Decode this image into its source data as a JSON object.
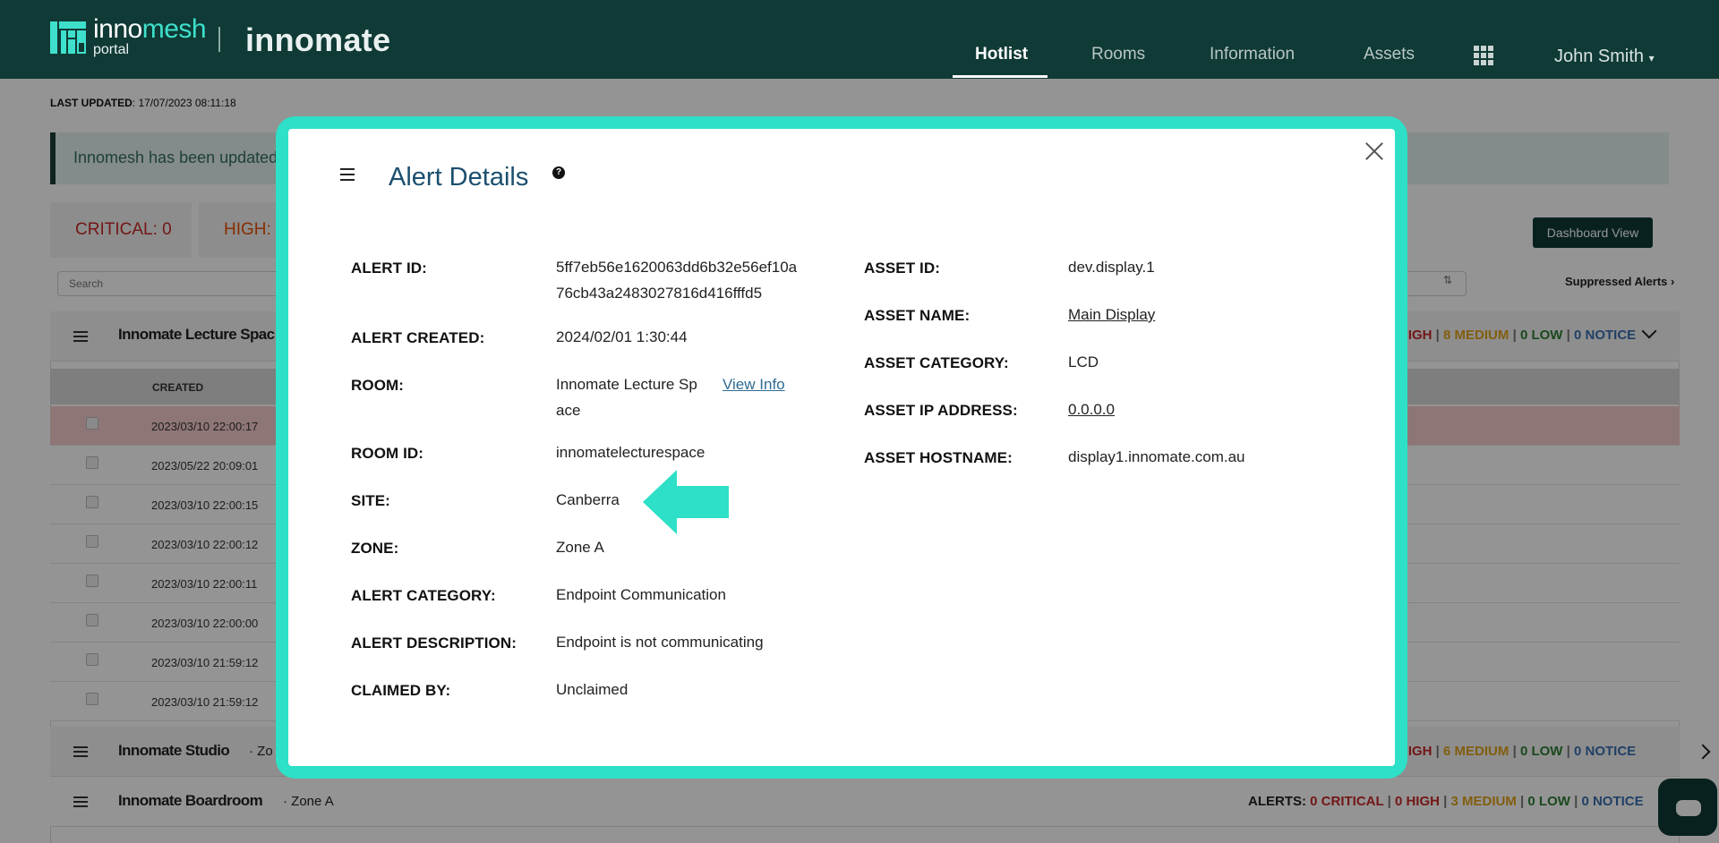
{
  "nav": {
    "brand_left": "inno",
    "brand_right": "mesh",
    "brand_sub": "portal",
    "brand2": "innomate",
    "links": [
      "Hotlist",
      "Rooms",
      "Information",
      "Assets"
    ],
    "active": "Hotlist",
    "user": "John Smith"
  },
  "page": {
    "last_updated_label": "LAST UPDATED",
    "last_updated_value": ": 17/07/2023 08:11:18",
    "banner": "Innomesh has been updated",
    "critical": "CRITICAL: 0",
    "high": "HIGH: ",
    "dashboard_button": "Dashboard View",
    "search_placeholder": "Search",
    "suppressed": "Suppressed Alerts",
    "groups": [
      {
        "title": "Innomate Lecture Spac",
        "zone": "",
        "summary": "HIGH | 8 MEDIUM | 0 LOW | 0 NOTICE"
      },
      {
        "title": "Innomate Studio",
        "zone": "· Zo",
        "summary": "HIGH | 6 MEDIUM | 0 LOW | 0 NOTICE"
      },
      {
        "title": "Innomate Boardroom",
        "zone": "· Zone A",
        "summary": "ALERTS: 0 CRITICAL | 0 HIGH | 3 MEDIUM | 0 LOW | 0 NOTICE"
      }
    ],
    "col_created": "CREATED",
    "rows": [
      "2023/03/10 22:00:17",
      "2023/05/22 20:09:01",
      "2023/03/10 22:00:15",
      "2023/03/10 22:00:12",
      "2023/03/10 22:00:11",
      "2023/03/10 22:00:00",
      "2023/03/10 21:59:12",
      "2023/03/10 21:59:12"
    ],
    "colors": {
      "critical": "#c62828",
      "high": "#e65100",
      "medium": "#e0a21a",
      "low": "#2e7d32",
      "notice": "#3a6fb0"
    }
  },
  "modal": {
    "title": "Alert Details",
    "help": "?",
    "left_fields": [
      {
        "label": "ALERT ID:",
        "value": "5ff7eb56e1620063dd6b32e56ef10a\n76cb43a2483027816d416fffd5"
      },
      {
        "label": "ALERT CREATED:",
        "value": "2024/02/01 1:30:44"
      },
      {
        "label": "ROOM:",
        "value": "Innomate Lecture Sp\nace",
        "link": "View Info"
      },
      {
        "label": "ROOM ID:",
        "value": "innomatelecturespace"
      },
      {
        "label": "SITE:",
        "value": "Canberra"
      },
      {
        "label": "ZONE:",
        "value": "Zone A"
      },
      {
        "label": "ALERT CATEGORY:",
        "value": "Endpoint Communication"
      },
      {
        "label": "ALERT DESCRIPTION:",
        "value": "Endpoint is not communicating"
      },
      {
        "label": "CLAIMED BY:",
        "value": "Unclaimed"
      }
    ],
    "right_fields": [
      {
        "label": "ASSET ID:",
        "value": "dev.display.1"
      },
      {
        "label": "ASSET NAME:",
        "value": "Main Display"
      },
      {
        "label": "ASSET CATEGORY:",
        "value": "LCD"
      },
      {
        "label": "ASSET IP ADDRESS:",
        "value": "0.0.0.0"
      },
      {
        "label": "ASSET HOSTNAME:",
        "value": "display1.innomate.com.au"
      }
    ],
    "frame_color": "#2de0c7",
    "title_color": "#1b4f6e"
  }
}
